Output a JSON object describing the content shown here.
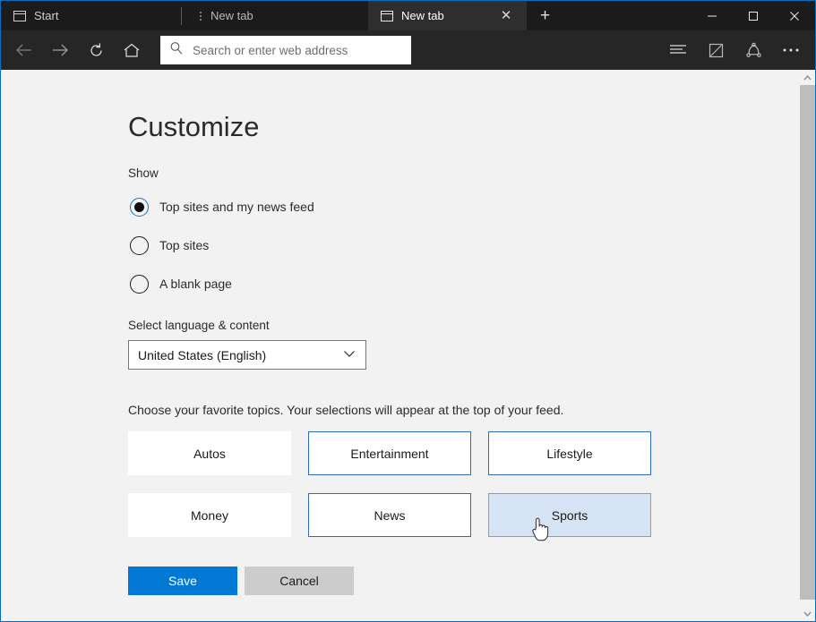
{
  "window": {
    "accent_border_color": "#0a6cbd",
    "controls": {
      "minimize": "─",
      "maximize": "☐",
      "close": "✕"
    }
  },
  "tabs": [
    {
      "title": "Start",
      "icon": "window-icon",
      "active": false,
      "has_close": false
    },
    {
      "title": "New tab",
      "icon": "loading-indicator",
      "active": false,
      "has_close": false
    },
    {
      "title": "New tab",
      "icon": "window-icon",
      "active": true,
      "has_close": true,
      "close_glyph": "✕"
    }
  ],
  "new_tab_button": {
    "label": "+",
    "name": "new-tab-button"
  },
  "toolbar": {
    "back": "←",
    "forward": "→",
    "refresh": "↻",
    "home": "home-icon",
    "address_placeholder": "Search or enter web address",
    "address_value": "",
    "search_icon": "search-icon",
    "hub_icon": "hub-icon",
    "note_icon": "make-a-web-note-icon",
    "share_icon": "share-icon",
    "more_icon": "more-settings-icon",
    "more_glyph": "•••"
  },
  "page": {
    "title": "Customize",
    "show_label": "Show",
    "radios": [
      {
        "label": "Top sites and my news feed",
        "checked": true
      },
      {
        "label": "Top sites",
        "checked": false
      },
      {
        "label": "A blank page",
        "checked": false
      }
    ],
    "language_label": "Select language & content",
    "language_value": "United States (English)",
    "language_chevron": "⌄",
    "topics_intro": "Choose your favorite topics. Your selections will appear at the top of your feed.",
    "topics": [
      {
        "label": "Autos",
        "state": "unselected"
      },
      {
        "label": "Entertainment",
        "state": "selected"
      },
      {
        "label": "Lifestyle",
        "state": "selected"
      },
      {
        "label": "Money",
        "state": "unselected"
      },
      {
        "label": "News",
        "state": "selected"
      },
      {
        "label": "Sports",
        "state": "hover"
      }
    ],
    "save_label": "Save",
    "cancel_label": "Cancel",
    "accent_color": "#0078d4",
    "selected_border_color": "#2e6bbd",
    "hover_fill_color": "#d6e3f4"
  },
  "scrollbar": {
    "up_arrow": "▲",
    "down_arrow": "▼"
  }
}
